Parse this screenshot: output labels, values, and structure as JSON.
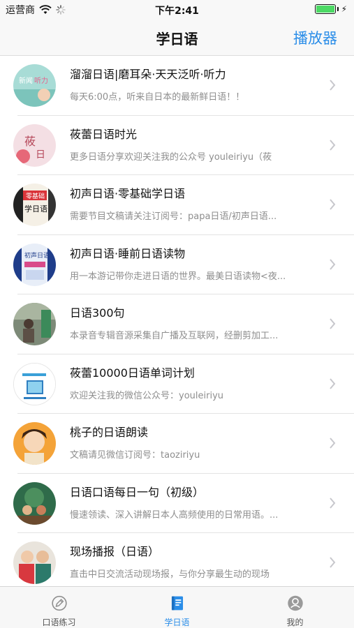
{
  "status_bar": {
    "carrier": "运营商",
    "time": "下午2:41",
    "battery_level": 1.0
  },
  "nav": {
    "title": "学日语",
    "right_button": "播放器"
  },
  "items": [
    {
      "title": "溜溜日语|磨耳朵·天天泛听·听力",
      "subtitle": "每天6:00点，听来自日本的最新鲜日语！！",
      "avatar_text": "新闻听力"
    },
    {
      "title": "莜蕾日语时光",
      "subtitle": "更多日语分享欢迎关注我的公众号 youleiriyu（莜",
      "avatar_text": "莜蕾日语"
    },
    {
      "title": "初声日语·零基础学日语",
      "subtitle": "需要节目文稿请关注订阅号：papa日语/初声日语...",
      "avatar_text": "零基础 学日语"
    },
    {
      "title": "初声日语·睡前日语读物",
      "subtitle": "用一本游记带你走进日语的世界。最美日语读物<夜...",
      "avatar_text": "初声日语"
    },
    {
      "title": "日语300句",
      "subtitle": "本录音专辑音源采集自广播及互联网，经删剪加工...",
      "avatar_text": ""
    },
    {
      "title": "莜蕾10000日语单词计划",
      "subtitle": "欢迎关注我的微信公众号：youleiriyu",
      "avatar_text": ""
    },
    {
      "title": "桃子的日语朗读",
      "subtitle": "文稿请见微信订阅号：taoziriyu",
      "avatar_text": ""
    },
    {
      "title": "日语口语每日一句（初级）",
      "subtitle": "慢速领读、深入讲解日本人高频使用的日常用语。...",
      "avatar_text": ""
    },
    {
      "title": "现场播报（日语）",
      "subtitle": "直击中日交流活动现场报，与你分享最生动的现场",
      "avatar_text": ""
    }
  ],
  "tabs": [
    {
      "label": "口语练习",
      "icon": "pencil-icon",
      "active": false
    },
    {
      "label": "学日语",
      "icon": "book-icon",
      "active": true
    },
    {
      "label": "我的",
      "icon": "user-icon",
      "active": false
    }
  ],
  "colors": {
    "accent": "#2a8de8",
    "battery_green": "#4cd964",
    "subtitle_gray": "#8e8e8e"
  }
}
